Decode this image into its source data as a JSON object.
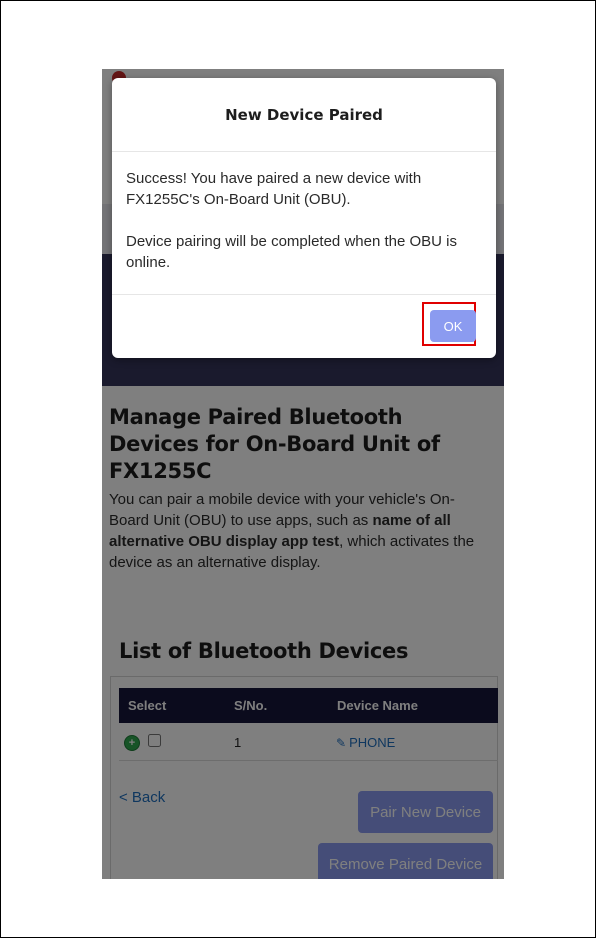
{
  "modal": {
    "title": "New Device Paired",
    "message_1": "Success! You have paired a new device with FX1255C's On-Board Unit (OBU).",
    "message_2": "Device pairing will be completed when the OBU is online.",
    "ok_label": "OK"
  },
  "page": {
    "title": "Manage Paired Bluetooth Devices for On-Board Unit of FX1255C",
    "description_pre": "You can pair a mobile device with your vehicle's On-Board Unit (OBU) to use apps, such as ",
    "description_bold": "name of all alternative OBU display app test",
    "description_post": ", which activates the device as an alternative display."
  },
  "list": {
    "title": "List of Bluetooth Devices",
    "columns": [
      "Select",
      "S/No.",
      "Device Name"
    ],
    "rows": [
      {
        "sno": "1",
        "device_name": "PHONE"
      }
    ]
  },
  "actions": {
    "back_label": "< Back",
    "pair_label": "Pair New Device",
    "remove_label": "Remove Paired Device"
  },
  "colors": {
    "nav": "#34345a",
    "table_header": "#16163a",
    "button": "#8b9bf0",
    "link": "#1f6fbf",
    "highlight": "#e00000"
  }
}
